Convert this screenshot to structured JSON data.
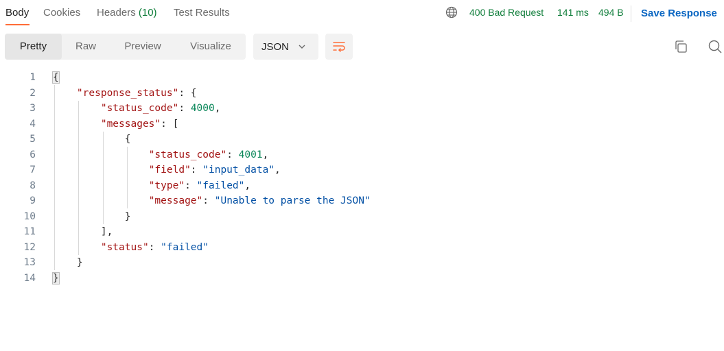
{
  "tabs": [
    {
      "label": "Body",
      "active": true
    },
    {
      "label": "Cookies"
    },
    {
      "label": "Headers",
      "count": "(10)"
    },
    {
      "label": "Test Results"
    }
  ],
  "status": {
    "globe_icon": "globe-icon",
    "code_text": "400 Bad Request",
    "time": "141 ms",
    "size": "494 B",
    "color": "#0f7d3a"
  },
  "save_response_label": "Save Response",
  "view_modes": [
    "Pretty",
    "Raw",
    "Preview",
    "Visualize"
  ],
  "active_view_mode": "Pretty",
  "format_select": {
    "value": "JSON",
    "icon": "chevron-down-icon"
  },
  "toolbar_icons": [
    "wrap-lines-icon",
    "copy-icon",
    "search-icon"
  ],
  "accent_color": "#ff6c37",
  "editor": {
    "lines": [
      [
        {
          "t": "{",
          "c": "p"
        }
      ],
      [
        {
          "t": "    ",
          "c": "p"
        },
        {
          "t": "\"response_status\"",
          "c": "k"
        },
        {
          "t": ": {",
          "c": "p"
        }
      ],
      [
        {
          "t": "        ",
          "c": "p"
        },
        {
          "t": "\"status_code\"",
          "c": "k"
        },
        {
          "t": ": ",
          "c": "p"
        },
        {
          "t": "4000",
          "c": "n"
        },
        {
          "t": ",",
          "c": "p"
        }
      ],
      [
        {
          "t": "        ",
          "c": "p"
        },
        {
          "t": "\"messages\"",
          "c": "k"
        },
        {
          "t": ": [",
          "c": "p"
        }
      ],
      [
        {
          "t": "            {",
          "c": "p"
        }
      ],
      [
        {
          "t": "                ",
          "c": "p"
        },
        {
          "t": "\"status_code\"",
          "c": "k"
        },
        {
          "t": ": ",
          "c": "p"
        },
        {
          "t": "4001",
          "c": "n"
        },
        {
          "t": ",",
          "c": "p"
        }
      ],
      [
        {
          "t": "                ",
          "c": "p"
        },
        {
          "t": "\"field\"",
          "c": "k"
        },
        {
          "t": ": ",
          "c": "p"
        },
        {
          "t": "\"input_data\"",
          "c": "s"
        },
        {
          "t": ",",
          "c": "p"
        }
      ],
      [
        {
          "t": "                ",
          "c": "p"
        },
        {
          "t": "\"type\"",
          "c": "k"
        },
        {
          "t": ": ",
          "c": "p"
        },
        {
          "t": "\"failed\"",
          "c": "s"
        },
        {
          "t": ",",
          "c": "p"
        }
      ],
      [
        {
          "t": "                ",
          "c": "p"
        },
        {
          "t": "\"message\"",
          "c": "k"
        },
        {
          "t": ": ",
          "c": "p"
        },
        {
          "t": "\"Unable to parse the JSON\"",
          "c": "s"
        }
      ],
      [
        {
          "t": "            }",
          "c": "p"
        }
      ],
      [
        {
          "t": "        ],",
          "c": "p"
        }
      ],
      [
        {
          "t": "        ",
          "c": "p"
        },
        {
          "t": "\"status\"",
          "c": "k"
        },
        {
          "t": ": ",
          "c": "p"
        },
        {
          "t": "\"failed\"",
          "c": "s"
        }
      ],
      [
        {
          "t": "    }",
          "c": "p"
        }
      ],
      [
        {
          "t": "}",
          "c": "p"
        }
      ]
    ]
  }
}
